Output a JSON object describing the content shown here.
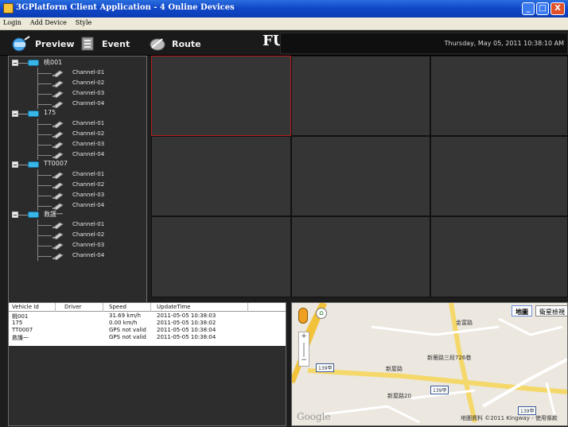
{
  "window": {
    "title": "3GPlatform Client Application - 4 Online Devices",
    "minimize": "_",
    "maximize": "□",
    "close": "X"
  },
  "menu": [
    "Login",
    "Add Device",
    "Style"
  ],
  "toolbar": {
    "preview_label": "Preview",
    "event_label": "Event",
    "route_label": "Route",
    "brand_text": "FU",
    "datetime": "Thursday, May 05, 2011 10:38:10 AM"
  },
  "tree": {
    "devices": [
      {
        "name": "桃001",
        "channels": [
          "Channel-01",
          "Channel-02",
          "Channel-03",
          "Channel-04"
        ]
      },
      {
        "name": "175",
        "channels": [
          "Channel-01",
          "Channel-02",
          "Channel-03",
          "Channel-04"
        ]
      },
      {
        "name": "TT0007",
        "channels": [
          "Channel-01",
          "Channel-02",
          "Channel-03",
          "Channel-04"
        ]
      },
      {
        "name": "救護一",
        "channels": [
          "Channel-01",
          "Channel-02",
          "Channel-03",
          "Channel-04"
        ]
      }
    ]
  },
  "video_grid": {
    "rows": 3,
    "cols": 3,
    "selected_index": 0
  },
  "vehicles": {
    "columns": [
      "Vehicle Id",
      "Driver",
      "Speed",
      "UpdateTime"
    ],
    "rows": [
      [
        "桃001",
        "",
        "31.69 km/h",
        "2011-05-05 10:38:03"
      ],
      [
        "175",
        "",
        "0.00 km/h",
        "2011-05-05 10:38:02"
      ],
      [
        "TT0007",
        "",
        "GPS not valid",
        "2011-05-05 10:38:04"
      ],
      [
        "救護一",
        "",
        "GPS not valid",
        "2011-05-05 10:38:04"
      ]
    ]
  },
  "map": {
    "map_button": "地圖",
    "satellite_button": "衛星檢視",
    "road_labels": [
      "新屋路",
      "新屋路20",
      "新雁路三段726巷",
      "金富路"
    ],
    "shields": [
      "139甲",
      "139甲",
      "139甲"
    ],
    "google_logo": "Google",
    "copyright": "地圖資料 ©2011 Kingway - 使用條款",
    "zoom_in": "+",
    "zoom_out": "−",
    "home_icon": "⌂"
  }
}
